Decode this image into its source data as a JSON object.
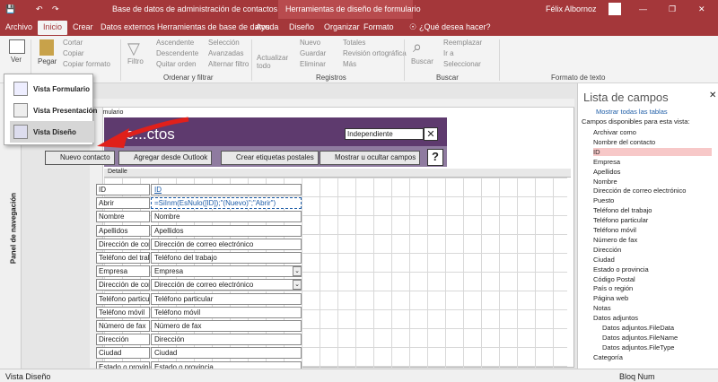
{
  "window": {
    "title": "Base de datos de administración de contactos",
    "tool_context": "Herramientas de diseño de formulario",
    "user": "Félix Albornoz"
  },
  "menu_tabs": [
    "Archivo",
    "Inicio",
    "Crear",
    "Datos externos",
    "Herramientas de base de datos",
    "Ayuda",
    "Diseño",
    "Organizar",
    "Formato",
    "¿Qué desea hacer?"
  ],
  "ribbon": {
    "ver": "Ver",
    "pegar": "Pegar",
    "cortar": "Cortar",
    "copiar": "Copiar",
    "copiar_formato": "Copiar formato",
    "filtro": "Filtro",
    "ascendente": "Ascendente",
    "descendente": "Descendente",
    "quitar_orden": "Quitar orden",
    "seleccion": "Selección",
    "avanzadas": "Avanzadas",
    "alternar_filtro": "Alternar filtro",
    "actualizar_todo": "Actualizar todo",
    "nuevo": "Nuevo",
    "guardar": "Guardar",
    "eliminar": "Eliminar",
    "totales": "Totales",
    "revision": "Revisión ortográfica",
    "mas": "Más",
    "buscar": "Buscar",
    "reemplazar": "Reemplazar",
    "ir_a": "Ir a",
    "seleccionar": "Seleccionar",
    "groups": {
      "ordenar": "Ordenar y filtrar",
      "registros": "Registros",
      "buscar": "Buscar",
      "formato_texto": "Formato de texto"
    }
  },
  "view_menu": {
    "formulario": "Vista Formulario",
    "presentacion": "Vista Presentación",
    "diseno": "Vista Diseño"
  },
  "form": {
    "tab": "Formulario",
    "header_title": "e...ctos",
    "dropdown": "Independiente",
    "buttons": [
      "Nuevo contacto",
      "Agregar desde Outlook",
      "Crear etiquetas postales",
      "Mostrar u ocultar campos"
    ],
    "help": "?",
    "detail": "Detalle",
    "fields": [
      {
        "label": "ID",
        "control": "ID",
        "combo": false
      },
      {
        "label": "Abrir",
        "control": "=SiInm(EsNulo([ID]);\"(Nuevo)\";\"Abrir\")",
        "combo": false
      },
      {
        "label": "Nombre",
        "control": "Nombre",
        "combo": false
      },
      {
        "label": "Apellidos",
        "control": "Apellidos",
        "combo": false
      },
      {
        "label": "Dirección de corr",
        "control": "Dirección de correo electrónico",
        "combo": false
      },
      {
        "label": "Teléfono del trab",
        "control": "Teléfono del trabajo",
        "combo": false
      },
      {
        "label": "Empresa",
        "control": "Empresa",
        "combo": true
      },
      {
        "label": "Dirección de corr",
        "control": "Dirección de correo electrónico",
        "combo": true
      },
      {
        "label": "Teléfono particul",
        "control": "Teléfono particular",
        "combo": false
      },
      {
        "label": "Teléfono móvil",
        "control": "Teléfono móvil",
        "combo": false
      },
      {
        "label": "Número de fax",
        "control": "Número de fax",
        "combo": false
      },
      {
        "label": "Dirección",
        "control": "Dirección",
        "combo": false
      },
      {
        "label": "Ciudad",
        "control": "Ciudad",
        "combo": false
      },
      {
        "label": "Estado o provinci",
        "control": "Estado o provincia",
        "combo": false
      }
    ]
  },
  "nav_pane": "Panel de navegación",
  "field_list": {
    "title": "Lista de campos",
    "show_all": "Mostrar todas las tablas",
    "available": "Campos disponibles para esta vista:",
    "items": [
      "Archivar como",
      "Nombre del contacto",
      "ID",
      "Empresa",
      "Apellidos",
      "Nombre",
      "Dirección de correo electrónico",
      "Puesto",
      "Teléfono del trabajo",
      "Teléfono particular",
      "Teléfono móvil",
      "Número de fax",
      "Dirección",
      "Ciudad",
      "Estado o provincia",
      "Código Postal",
      "País o región",
      "Página web",
      "Notas",
      "Datos adjuntos",
      "Datos adjuntos.FileData",
      "Datos adjuntos.FileName",
      "Datos adjuntos.FileType",
      "Categoría"
    ],
    "selected": "ID"
  },
  "status": {
    "left": "Vista Diseño",
    "right": "Bloq Num"
  },
  "colors": {
    "access": "#a4373a",
    "header": "#5e3a6e",
    "arrow": "#e0201b"
  }
}
